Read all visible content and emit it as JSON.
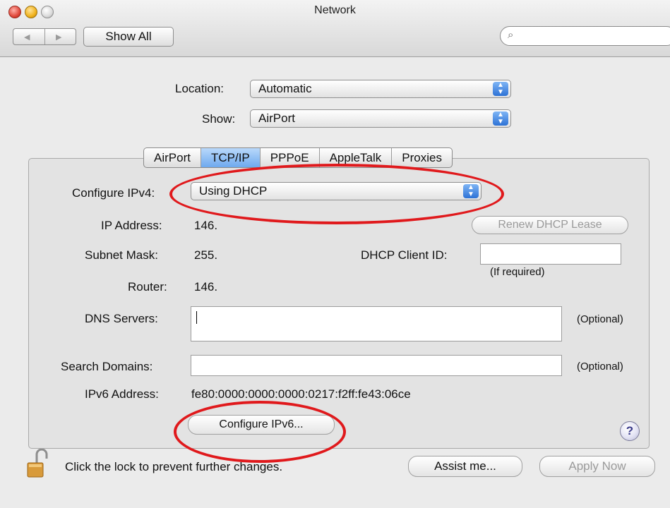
{
  "window": {
    "title": "Network"
  },
  "toolbar": {
    "show_all": "Show All",
    "search_placeholder": ""
  },
  "location": {
    "label": "Location:",
    "value": "Automatic"
  },
  "show": {
    "label": "Show:",
    "value": "AirPort"
  },
  "tabs": [
    {
      "label": "AirPort"
    },
    {
      "label": "TCP/IP"
    },
    {
      "label": "PPPoE"
    },
    {
      "label": "AppleTalk"
    },
    {
      "label": "Proxies"
    }
  ],
  "tcpip": {
    "configure_ipv4": {
      "label": "Configure IPv4:",
      "value": "Using DHCP"
    },
    "ip_address": {
      "label": "IP Address:",
      "value": "146."
    },
    "renew_button": "Renew DHCP Lease",
    "subnet_mask": {
      "label": "Subnet Mask:",
      "value": "255."
    },
    "dhcp_client_id": {
      "label": "DHCP Client ID:",
      "hint": "(If required)",
      "value": ""
    },
    "router": {
      "label": "Router:",
      "value": "146."
    },
    "dns_servers": {
      "label": "DNS Servers:",
      "value": "",
      "note": "(Optional)"
    },
    "search_domains": {
      "label": "Search Domains:",
      "value": "",
      "note": "(Optional)"
    },
    "ipv6_address": {
      "label": "IPv6 Address:",
      "value": "fe80:0000:0000:0000:0217:f2ff:fe43:06ce"
    },
    "configure_ipv6_button": "Configure IPv6...",
    "help": "?"
  },
  "footer": {
    "lock_text": "Click the lock to prevent further changes.",
    "assist_button": "Assist me...",
    "apply_button": "Apply Now"
  },
  "annotation_color": "#e0191c"
}
